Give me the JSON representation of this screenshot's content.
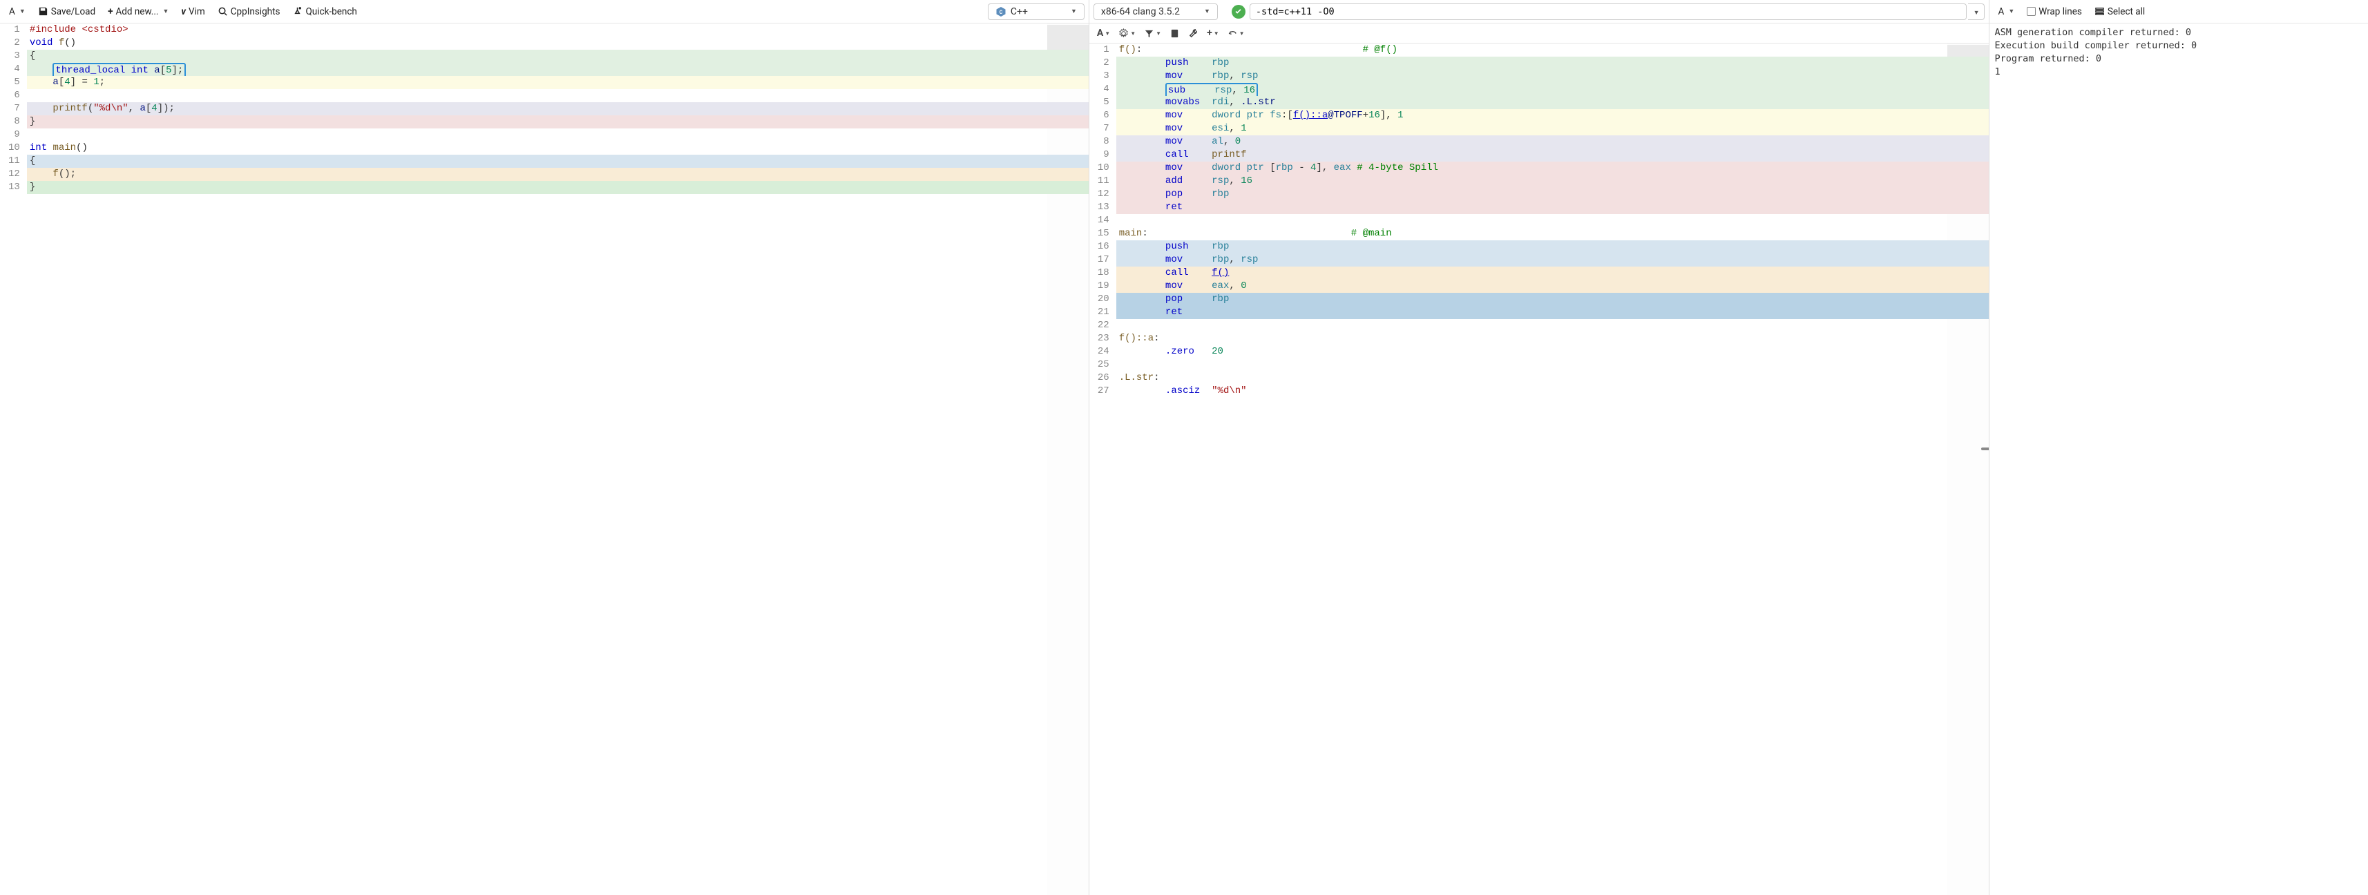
{
  "source_toolbar": {
    "font_label": "A",
    "saveload": "Save/Load",
    "addnew": "Add new...",
    "vim": "Vim",
    "cppinsights": "CppInsights",
    "quickbench": "Quick-bench",
    "language": "C++"
  },
  "source_code": [
    {
      "n": 1,
      "bg": "",
      "html": "<span class='pre'>#include</span> <span class='pre'>&lt;cstdio&gt;</span>"
    },
    {
      "n": 2,
      "bg": "",
      "html": "<span class='kw'>void</span> <span class='fnname'>f</span><span class='punct'>(</span><span class='punct'>)</span>"
    },
    {
      "n": 3,
      "bg": "bg-green",
      "html": "<span class='punct'>{</span>"
    },
    {
      "n": 4,
      "bg": "bg-green",
      "html": "    <span class='sel-box'><span class='kw'>thread_local</span> <span class='kw'>int</span> <span class='ident'>a</span><span class='punct'>[</span><span class='num'>5</span><span class='punct'>]</span><span class='punct'>;</span></span>"
    },
    {
      "n": 5,
      "bg": "bg-yellow",
      "html": "    <span class='ident'>a</span><span class='punct'>[</span><span class='num'>4</span><span class='punct'>]</span> <span class='punct'>=</span> <span class='num'>1</span><span class='punct'>;</span>"
    },
    {
      "n": 6,
      "bg": "",
      "html": ""
    },
    {
      "n": 7,
      "bg": "bg-lav",
      "html": "    <span class='fnname'>printf</span><span class='punct'>(</span><span class='str'>\"%d\\n\"</span><span class='punct'>,</span> <span class='ident'>a</span><span class='punct'>[</span><span class='num'>4</span><span class='punct'>]</span><span class='punct'>)</span><span class='punct'>;</span>"
    },
    {
      "n": 8,
      "bg": "bg-pink",
      "html": "<span class='punct'>}</span>"
    },
    {
      "n": 9,
      "bg": "",
      "html": ""
    },
    {
      "n": 10,
      "bg": "",
      "html": "<span class='kw'>int</span> <span class='fnname'>main</span><span class='punct'>(</span><span class='punct'>)</span>"
    },
    {
      "n": 11,
      "bg": "bg-blue",
      "html": "<span class='punct'>{</span>"
    },
    {
      "n": 12,
      "bg": "bg-cream",
      "html": "    <span class='fnname'>f</span><span class='punct'>(</span><span class='punct'>)</span><span class='punct'>;</span>"
    },
    {
      "n": 13,
      "bg": "bg-green2",
      "html": "<span class='punct'>}</span>"
    }
  ],
  "asm_toolbar": {
    "compiler": "x86-64 clang 3.5.2",
    "options": "-std=c++11 -O0"
  },
  "asm_code": [
    {
      "n": 1,
      "bg": "",
      "html": "<span class='lbl'>f()</span><span class='punct'>:</span>                                      <span class='cmt'># @f()</span>"
    },
    {
      "n": 2,
      "bg": "bg-green",
      "html": "        <span class='mnem'>push</span>    <span class='reg'>rbp</span>"
    },
    {
      "n": 3,
      "bg": "bg-green",
      "html": "        <span class='mnem'>mov</span>     <span class='reg'>rbp</span><span class='punct'>,</span> <span class='reg'>rsp</span>"
    },
    {
      "n": 4,
      "bg": "bg-green",
      "html": "        <span class='sel-box'><span class='mnem'>sub</span>     <span class='reg'>rsp</span><span class='punct'>,</span> <span class='num'>16</span></span>"
    },
    {
      "n": 5,
      "bg": "bg-green",
      "html": "        <span class='mnem'>movabs</span>  <span class='reg'>rdi</span><span class='punct'>,</span> <span class='ident'>.L.str</span>"
    },
    {
      "n": 6,
      "bg": "bg-yellow",
      "html": "        <span class='mnem'>mov</span>     <span class='reg'>dword ptr</span> <span class='reg'>fs</span><span class='punct'>:</span><span class='punct'>[</span><span class='link'>f()::a</span><span class='ident'>@TPOFF</span><span class='punct'>+</span><span class='num'>16</span><span class='punct'>]</span><span class='punct'>,</span> <span class='num'>1</span>"
    },
    {
      "n": 7,
      "bg": "bg-yellow",
      "html": "        <span class='mnem'>mov</span>     <span class='reg'>esi</span><span class='punct'>,</span> <span class='num'>1</span>"
    },
    {
      "n": 8,
      "bg": "bg-lav",
      "html": "        <span class='mnem'>mov</span>     <span class='reg'>al</span><span class='punct'>,</span> <span class='num'>0</span>"
    },
    {
      "n": 9,
      "bg": "bg-lav",
      "html": "        <span class='mnem'>call</span>    <span class='lbl'>printf</span>"
    },
    {
      "n": 10,
      "bg": "bg-pink",
      "html": "        <span class='mnem'>mov</span>     <span class='reg'>dword ptr</span> <span class='punct'>[</span><span class='reg'>rbp</span> <span class='punct'>-</span> <span class='num'>4</span><span class='punct'>]</span><span class='punct'>,</span> <span class='reg'>eax</span> <span class='cmt'># 4-byte Spill</span>"
    },
    {
      "n": 11,
      "bg": "bg-pink",
      "html": "        <span class='mnem'>add</span>     <span class='reg'>rsp</span><span class='punct'>,</span> <span class='num'>16</span>"
    },
    {
      "n": 12,
      "bg": "bg-pink",
      "html": "        <span class='mnem'>pop</span>     <span class='reg'>rbp</span>"
    },
    {
      "n": 13,
      "bg": "bg-pink",
      "html": "        <span class='mnem'>ret</span>"
    },
    {
      "n": 14,
      "bg": "",
      "html": ""
    },
    {
      "n": 15,
      "bg": "",
      "html": "<span class='lbl'>main</span><span class='punct'>:</span>                                   <span class='cmt'># @main</span>"
    },
    {
      "n": 16,
      "bg": "bg-blue",
      "html": "        <span class='mnem'>push</span>    <span class='reg'>rbp</span>"
    },
    {
      "n": 17,
      "bg": "bg-blue",
      "html": "        <span class='mnem'>mov</span>     <span class='reg'>rbp</span><span class='punct'>,</span> <span class='reg'>rsp</span>"
    },
    {
      "n": 18,
      "bg": "bg-cream",
      "html": "        <span class='mnem'>call</span>    <span class='link'>f()</span>"
    },
    {
      "n": 19,
      "bg": "bg-cream",
      "html": "        <span class='mnem'>mov</span>     <span class='reg'>eax</span><span class='punct'>,</span> <span class='num'>0</span>"
    },
    {
      "n": 20,
      "bg": "bg-bluesel",
      "html": "        <span class='mnem'>pop</span>     <span class='reg'>rbp</span>"
    },
    {
      "n": 21,
      "bg": "bg-bluesel",
      "html": "        <span class='mnem'>ret</span>"
    },
    {
      "n": 22,
      "bg": "",
      "html": ""
    },
    {
      "n": 23,
      "bg": "",
      "html": "<span class='lbl'>f()::a</span><span class='punct'>:</span>"
    },
    {
      "n": 24,
      "bg": "",
      "html": "        <span class='dir'>.zero</span>   <span class='num'>20</span>"
    },
    {
      "n": 25,
      "bg": "",
      "html": ""
    },
    {
      "n": 26,
      "bg": "",
      "html": "<span class='lbl'>.L.str</span><span class='punct'>:</span>"
    },
    {
      "n": 27,
      "bg": "",
      "html": "        <span class='dir'>.asciz</span>  <span class='str'>\"%d\\n\"</span>"
    }
  ],
  "output_toolbar": {
    "font_label": "A",
    "wrap": "Wrap lines",
    "selectall": "Select all"
  },
  "output_lines": [
    "ASM generation compiler returned: 0",
    "Execution build compiler returned: 0",
    "Program returned: 0",
    "1"
  ]
}
